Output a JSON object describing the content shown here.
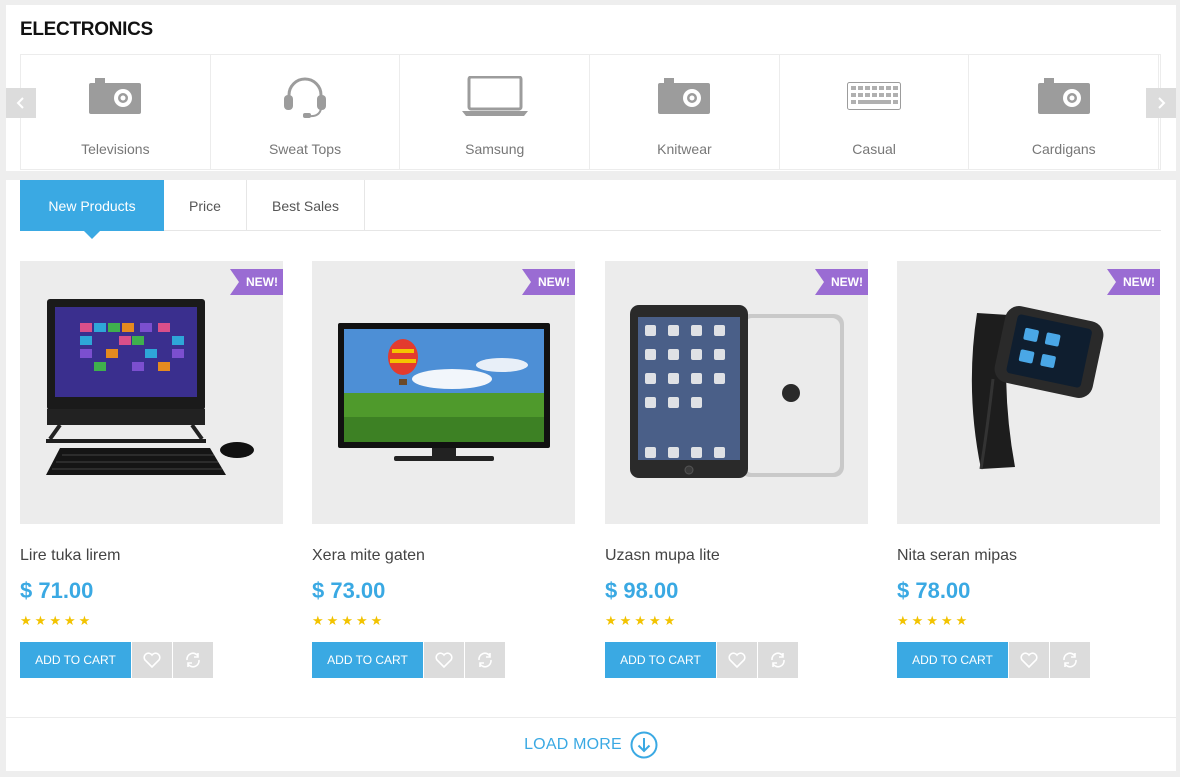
{
  "section": {
    "title": "ELECTRONICS"
  },
  "categories": [
    {
      "label": "Televisions",
      "icon": "camera-icon"
    },
    {
      "label": "Sweat Tops",
      "icon": "headset-icon"
    },
    {
      "label": "Samsung",
      "icon": "laptop-icon"
    },
    {
      "label": "Knitwear",
      "icon": "camera-icon"
    },
    {
      "label": "Casual",
      "icon": "keyboard-icon"
    },
    {
      "label": "Cardigans",
      "icon": "camera-icon"
    }
  ],
  "tabs": [
    {
      "label": "New Products",
      "active": true
    },
    {
      "label": "Price",
      "active": false
    },
    {
      "label": "Best Sales",
      "active": false
    }
  ],
  "products": [
    {
      "name": "Lire tuka lirem",
      "price": "$ 71.00",
      "badge": "NEW!",
      "rating": 5,
      "image": "all-in-one-pc"
    },
    {
      "name": "Xera mite gaten",
      "price": "$ 73.00",
      "badge": "NEW!",
      "rating": 5,
      "image": "flat-screen-tv"
    },
    {
      "name": "Uzasn mupa lite",
      "price": "$ 98.00",
      "badge": "NEW!",
      "rating": 5,
      "image": "tablet"
    },
    {
      "name": "Nita seran mipas",
      "price": "$ 78.00",
      "badge": "NEW!",
      "rating": 5,
      "image": "smartwatch"
    }
  ],
  "labels": {
    "add_to_cart": "ADD TO CART",
    "load_more": "LOAD MORE"
  },
  "colors": {
    "accent": "#3aa9e3",
    "badge": "#9a6cd3",
    "star": "#f2c300",
    "icon_gray": "#9c9c9c"
  }
}
